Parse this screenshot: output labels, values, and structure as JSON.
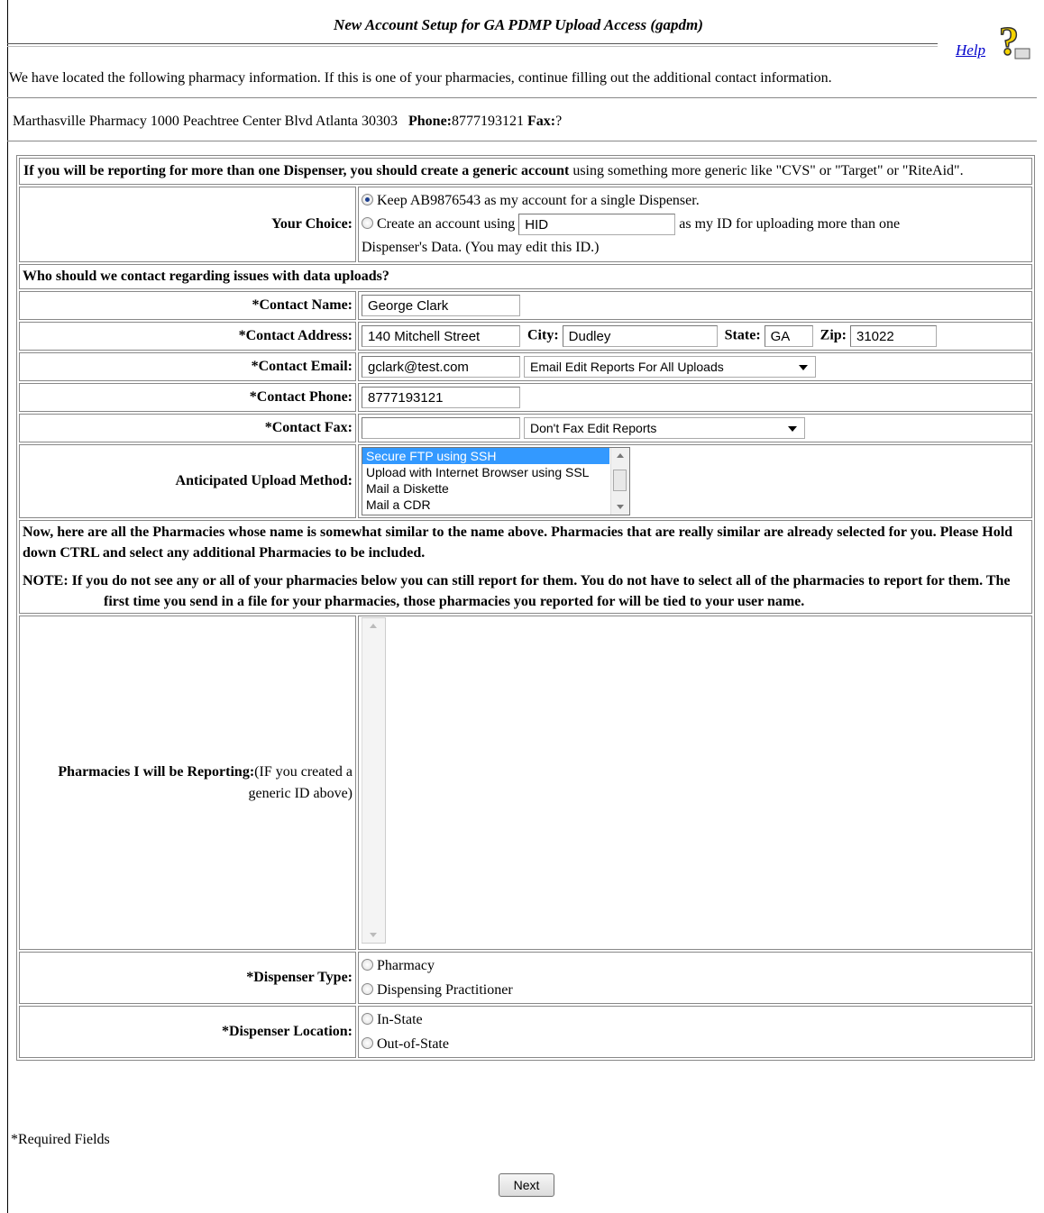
{
  "header": {
    "title": "New Account Setup for GA PDMP Upload Access (gapdm)",
    "help_label": "Help"
  },
  "intro_text": "We have located the following pharmacy information. If this is one of your pharmacies, continue filling out the additional contact information.",
  "pharmacy": {
    "info": "Marthasville Pharmacy 1000 Peachtree Center Blvd Atlanta 30303",
    "phone_label": "Phone:",
    "phone": "8777193121",
    "fax_label": "Fax:",
    "fax": "?"
  },
  "generic_notice": {
    "bold": "If you will be reporting for more than one Dispenser, you should create a generic account",
    "rest": " using something more generic like \"CVS\" or \"Target\" or \"RiteAid\"."
  },
  "choice": {
    "label": "Your Choice:",
    "option1": "Keep AB9876543 as my account for a single Dispenser.",
    "option2_pre": "Create an account using",
    "option2_value": "HID",
    "option2_post": "as my ID for uploading more than one",
    "option2_cont": "Dispenser's Data. (You may edit this ID.)",
    "selected": "option1"
  },
  "contact_heading": "Who should we contact regarding issues with data uploads?",
  "contact": {
    "name_label": "*Contact Name:",
    "name": "George Clark",
    "address_label": "*Contact Address:",
    "address": "140 Mitchell Street",
    "city_label": "City:",
    "city": "Dudley",
    "state_label": "State:",
    "state": "GA",
    "zip_label": "Zip:",
    "zip": "31022",
    "email_label": "*Contact Email:",
    "email": "gclark@test.com",
    "email_reports": "Email Edit Reports For All Uploads",
    "phone_label": "*Contact Phone:",
    "phone": "8777193121",
    "fax_label": "*Contact Fax:",
    "fax": "",
    "fax_reports": "Don't Fax Edit Reports"
  },
  "upload_method": {
    "label": "Anticipated Upload Method:",
    "options": [
      "Secure FTP using SSH",
      "Upload with Internet Browser using SSL",
      "Mail a Diskette",
      "Mail a CDR"
    ]
  },
  "similar_notice": {
    "para1": "Now, here are all the Pharmacies whose name is somewhat similar to the name above. Pharmacies that are really similar are already selected for you. Please Hold down CTRL and select any additional Pharmacies to be included.",
    "note": "NOTE: If you do not see any or all of your pharmacies below you can still report for them. You do not have to select all of the pharmacies to report for them. The first time you send in a file for your pharmacies, those pharmacies you reported for will be tied to your user name."
  },
  "pharmacies_reporting": {
    "label": "Pharmacies I will be Reporting:",
    "label_note": "(IF you created a generic ID above)"
  },
  "dispenser_type": {
    "label": "*Dispenser Type:",
    "options": [
      "Pharmacy",
      "Dispensing Practitioner"
    ]
  },
  "dispenser_location": {
    "label": "*Dispenser Location:",
    "options": [
      "In-State",
      "Out-of-State"
    ]
  },
  "footer": {
    "required": "*Required Fields",
    "next": "Next"
  }
}
